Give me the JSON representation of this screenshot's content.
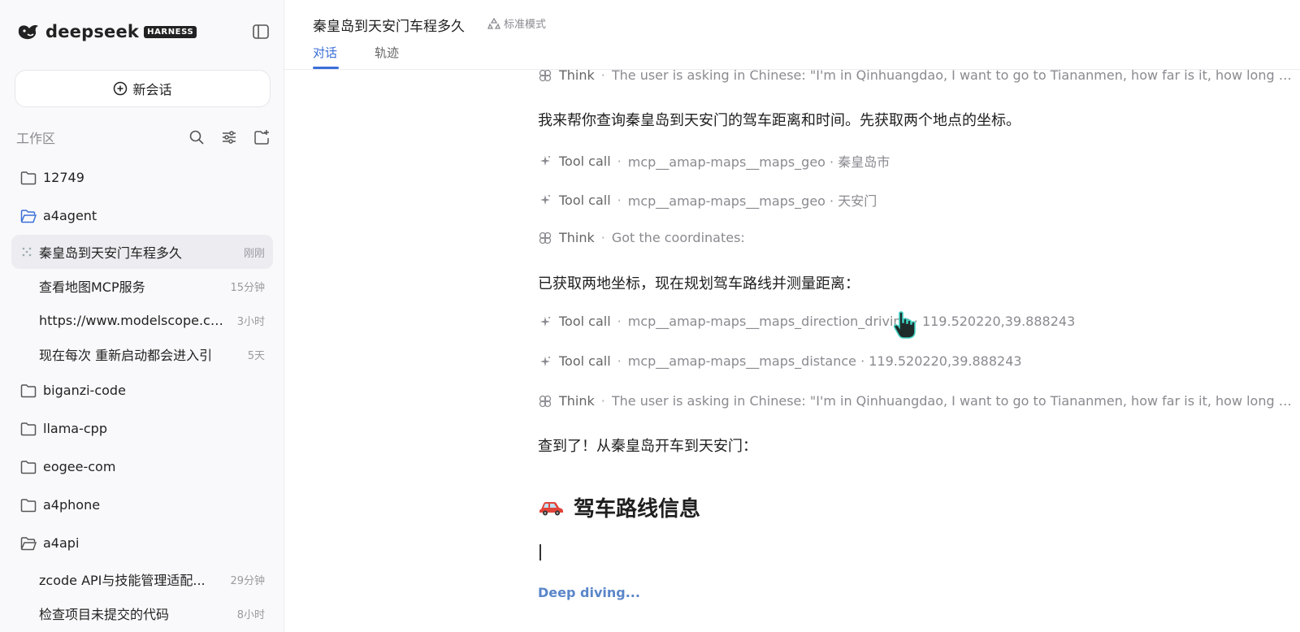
{
  "sidebar": {
    "brand": "deepseek",
    "badge": "HARNESS",
    "new_chat_label": "新会话",
    "workspace_label": "工作区",
    "tree": [
      {
        "type": "folder",
        "name": "12749"
      },
      {
        "type": "folder-open",
        "name": "a4agent"
      },
      {
        "type": "chat",
        "title": "秦皇岛到天安门车程多久",
        "time": "刚刚",
        "active": true
      },
      {
        "type": "chat",
        "title": "查看地图MCP服务",
        "time": "15分钟"
      },
      {
        "type": "chat",
        "title": "https://www.modelscope.cn...",
        "time": "3小时"
      },
      {
        "type": "chat",
        "title": "现在每次 重新启动都会进入引",
        "time": "5天"
      },
      {
        "type": "folder",
        "name": "biganzi-code"
      },
      {
        "type": "folder",
        "name": "llama-cpp"
      },
      {
        "type": "folder",
        "name": "eogee-com"
      },
      {
        "type": "folder",
        "name": "a4phone"
      },
      {
        "type": "folder-open",
        "name": "a4api"
      },
      {
        "type": "chat",
        "title": "zcode API与技能管理适配...",
        "time": "29分钟"
      },
      {
        "type": "chat",
        "title": "检查项目未提交的代码",
        "time": "8小时"
      }
    ]
  },
  "header": {
    "title": "秦皇岛到天安门车程多久",
    "mode": "标准模式",
    "tabs": [
      "对话",
      "轨迹"
    ]
  },
  "messages": [
    {
      "kind": "think",
      "label": "Think",
      "detail": "The user is asking in Chinese: \"I'm in Qinhuangdao, I want to go to Tiananmen, how far is it, how long by ca..."
    },
    {
      "kind": "text",
      "text": "我来帮你查询秦皇岛到天安门的驾车距离和时间。先获取两个地点的坐标。"
    },
    {
      "kind": "tool",
      "label": "Tool call",
      "detail": "mcp__amap-maps__maps_geo · 秦皇岛市"
    },
    {
      "kind": "tool",
      "label": "Tool call",
      "detail": "mcp__amap-maps__maps_geo · 天安门"
    },
    {
      "kind": "think",
      "label": "Think",
      "detail": "Got the coordinates:"
    },
    {
      "kind": "text",
      "text": "已获取两地坐标，现在规划驾车路线并测量距离："
    },
    {
      "kind": "tool",
      "label": "Tool call",
      "detail": "mcp__amap-maps__maps_direction_driving · 119.520220,39.888243"
    },
    {
      "kind": "tool",
      "label": "Tool call",
      "detail": "mcp__amap-maps__maps_distance · 119.520220,39.888243"
    },
    {
      "kind": "think",
      "label": "Think",
      "detail": "The user is asking in Chinese: \"I'm in Qinhuangdao, I want to go to Tiananmen, how far is it, how long by ca..."
    },
    {
      "kind": "text",
      "text": "查到了！从秦皇岛开车到天安门："
    }
  ],
  "section_heading": "驾车路线信息",
  "status": "Deep diving...",
  "colors": {
    "accent": "#3b6fd8",
    "status": "#5a86c9"
  }
}
